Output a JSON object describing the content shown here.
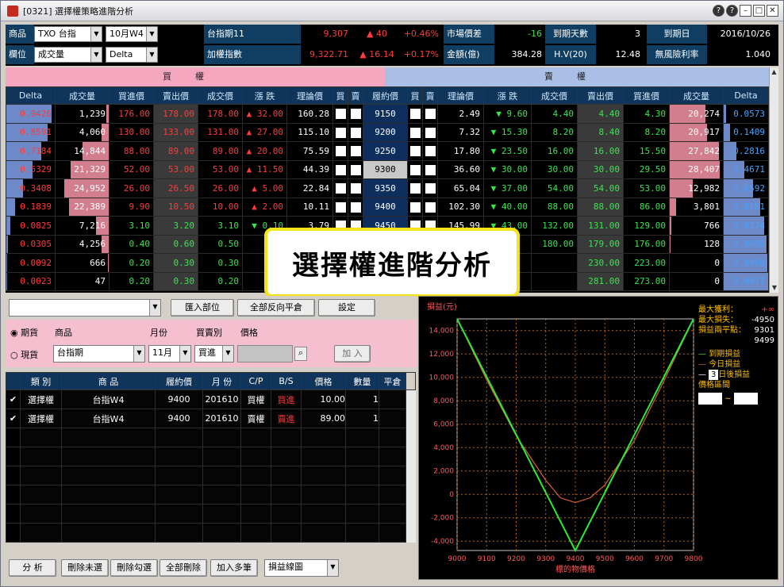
{
  "window": {
    "title": "[0321] 選擇權策略進階分析",
    "btn_help": "?",
    "btn_min": "–",
    "btn_max": "□",
    "btn_close": "✕"
  },
  "selectors": {
    "product_label": "商品",
    "product_value": "TXO 台指",
    "month_value": "10月W4",
    "position_label": "欄位",
    "column_value": "成交量",
    "greek_value": "Delta"
  },
  "market": {
    "idx_name": "台指期11",
    "idx_price": "9,307",
    "idx_change": "▲ 40",
    "idx_pct": "+0.46%",
    "wtd_name": "加權指數",
    "wtd_price": "9,322.71",
    "wtd_change": "▲ 16.14",
    "wtd_pct": "+0.17%",
    "spread_label": "市場價差",
    "spread_value": "-16",
    "amount_label": "金額(億)",
    "amount_value": "384.28",
    "days_label": "到期天數",
    "days_value": "3",
    "hv_label": "H.V(20)",
    "hv_value": "12.48",
    "expiry_label": "到期日",
    "expiry_value": "2016/10/26",
    "rate_label": "無風險利率",
    "rate_value": "1.040"
  },
  "chain": {
    "buy_header": "買權",
    "sell_header": "賣權",
    "headers": [
      "Delta",
      "成交量",
      "買進價",
      "賣出價",
      "成交價",
      "漲 跌",
      "理論價",
      "買",
      "賣",
      "履約價",
      "買",
      "賣",
      "理論價",
      "漲 跌",
      "成交價",
      "賣出價",
      "買進價",
      "成交量",
      "Delta"
    ],
    "rows": [
      [
        "0.9426",
        "1,239",
        "176.00",
        "178.00",
        "178.00",
        "▲ 32.00",
        "160.28",
        "9150",
        "2.49",
        "▼ 9.60",
        "4.40",
        "4.40",
        "4.30",
        "20,274",
        "0.0573"
      ],
      [
        "0.8591",
        "4,060",
        "130.00",
        "133.00",
        "131.00",
        "▲ 27.00",
        "115.10",
        "9200",
        "7.32",
        "▼ 15.30",
        "8.20",
        "8.40",
        "8.20",
        "20,917",
        "0.1409"
      ],
      [
        "0.7184",
        "14,844",
        "88.00",
        "89.00",
        "89.00",
        "▲ 20.00",
        "75.59",
        "9250",
        "17.80",
        "▼ 23.50",
        "16.00",
        "16.00",
        "15.50",
        "27,842",
        "0.2816"
      ],
      [
        "0.5329",
        "21,329",
        "52.00",
        "53.00",
        "53.00",
        "▲ 11.50",
        "44.39",
        "9300",
        "36.60",
        "▼ 30.00",
        "30.00",
        "30.00",
        "29.50",
        "28,407",
        "0.4671"
      ],
      [
        "0.3408",
        "24,952",
        "26.00",
        "26.50",
        "26.00",
        "▲ 5.00",
        "22.84",
        "9350",
        "65.04",
        "▼ 37.00",
        "54.00",
        "54.00",
        "53.00",
        "12,982",
        "0.6592"
      ],
      [
        "0.1839",
        "22,389",
        "9.90",
        "10.50",
        "10.00",
        "▲ 2.00",
        "10.11",
        "9400",
        "102.30",
        "▼ 40.00",
        "88.00",
        "88.00",
        "86.00",
        "3,801",
        "0.8161"
      ],
      [
        "0.0825",
        "7,216",
        "3.10",
        "3.20",
        "3.10",
        "▼ 0.10",
        "3.79",
        "9450",
        "145.99",
        "▼ 43.00",
        "132.00",
        "131.00",
        "129.00",
        "766",
        "0.9174"
      ],
      [
        "0.0305",
        "4,256",
        "0.40",
        "0.60",
        "0.50",
        "▼",
        "",
        "",
        "",
        "",
        "180.00",
        "179.00",
        "176.00",
        "128",
        "0.9695"
      ],
      [
        "0.0092",
        "666",
        "0.20",
        "0.30",
        "0.30",
        "",
        "",
        "",
        "",
        "",
        "",
        "230.00",
        "223.00",
        "0",
        "0.9908"
      ],
      [
        "0.0023",
        "47",
        "0.20",
        "0.30",
        "0.20",
        "",
        "",
        "",
        "",
        "",
        "",
        "281.00",
        "273.00",
        "0",
        "0.9977"
      ]
    ]
  },
  "overlay_text": "選擇權進階分析",
  "toolbar": {
    "import_btn": "匯入部位",
    "reverse_btn": "全部反向平倉",
    "settings_btn": "設定"
  },
  "order": {
    "radio_futures": "期貨",
    "radio_spot": "現貨",
    "product_lbl": "商品",
    "month_lbl": "月份",
    "side_lbl": "買賣別",
    "price_lbl": "價格",
    "product_val": "台指期",
    "month_val": "11月",
    "side_val": "買進",
    "add_btn": "加 入"
  },
  "positions": {
    "headers": [
      "類 別",
      "商 品",
      "履約價",
      "月 份",
      "C/P",
      "B/S",
      "價格",
      "數量",
      "平倉"
    ],
    "rows": [
      [
        "選擇權",
        "台指W4",
        "9400",
        "201610",
        "買權",
        "買進",
        "10.00",
        "1"
      ],
      [
        "選擇權",
        "台指W4",
        "9400",
        "201610",
        "賣權",
        "賣進",
        "89.00",
        "1"
      ]
    ]
  },
  "bottom": {
    "analyze": "分 析",
    "del_unsel": "刪除未選",
    "del_sel": "刪除勾選",
    "del_all": "全部刪除",
    "add_multi": "加入多筆",
    "chart_type": "損益線圖"
  },
  "chart_data": {
    "type": "line",
    "ylabel": "損益(元)",
    "xlabel": "標的物價格",
    "x": [
      9000,
      9100,
      9200,
      9300,
      9400,
      9500,
      9600,
      9700,
      9800
    ],
    "yticks": [
      14000,
      12000,
      10000,
      8000,
      6000,
      4000,
      2000,
      0,
      -2000,
      -4000
    ],
    "ytick_labels": [
      "14,000",
      "12,000",
      "10,000",
      "8,000",
      "6,000",
      "4,000",
      "2,000",
      "0",
      "-2,000",
      "-4,000"
    ],
    "xtick_labels": [
      "9000",
      "9100",
      "9200",
      "9300",
      "9400",
      "9500",
      "9600",
      "9700",
      "9800"
    ],
    "ylim": [
      -4800,
      15000
    ],
    "xlim": [
      9000,
      9800
    ],
    "series": [
      {
        "name": "到期損益",
        "color": "#2ee83a",
        "x": [
          9000,
          9400,
          9800
        ],
        "y": [
          15000,
          -4950,
          15050
        ]
      },
      {
        "name": "今日損益",
        "color": "#d8623a",
        "x": [
          9000,
          9100,
          9200,
          9300,
          9350,
          9400,
          9450,
          9500,
          9600,
          9700,
          9800
        ],
        "y": [
          15000,
          9800,
          5000,
          1200,
          -300,
          -700,
          -300,
          800,
          4600,
          9700,
          15000
        ]
      }
    ]
  },
  "legend": {
    "max_profit_lbl": "最大獲利：",
    "max_profit_val": "+∞",
    "max_loss_lbl": "最大損失：",
    "max_loss_val": "-4950",
    "be_lbl": "損益兩平點：",
    "be1": "9301",
    "be2": "9499",
    "s1": "到期損益",
    "s2": "今日損益",
    "days": "3",
    "s3": "日後損益",
    "range_lbl": "價格區間",
    "tilde": "~"
  }
}
